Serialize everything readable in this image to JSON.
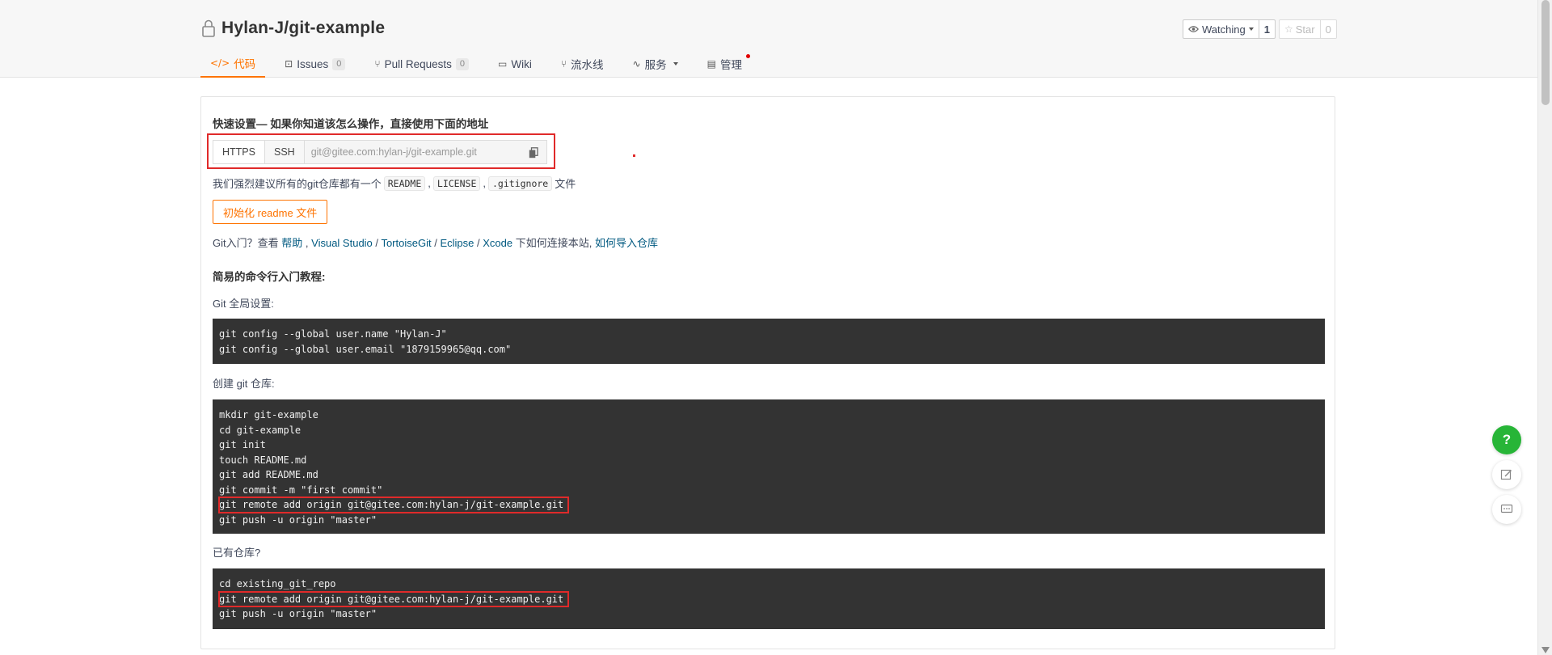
{
  "repo": {
    "title": "Hylan-J/git-example"
  },
  "watch": {
    "label": "Watching",
    "count": "1"
  },
  "star": {
    "label": "Star",
    "count": "0"
  },
  "tabs": [
    {
      "icon": "</>",
      "label": "代码"
    },
    {
      "icon": "⊡",
      "label": "Issues",
      "count": "0"
    },
    {
      "icon": "⑂",
      "label": "Pull Requests",
      "count": "0"
    },
    {
      "icon": "▭",
      "label": "Wiki"
    },
    {
      "icon": "⑂",
      "label": "流水线"
    },
    {
      "icon": "∿",
      "label": "服务"
    },
    {
      "icon": "▤",
      "label": "管理"
    }
  ],
  "quick_setup": {
    "title": "快速设置— 如果你知道该怎么操作，直接使用下面的地址",
    "https_label": "HTTPS",
    "ssh_label": "SSH",
    "url": "git@gitee.com:hylan-j/git-example.git"
  },
  "recommend": {
    "prefix": "我们强烈建议所有的git仓库都有一个",
    "files": [
      "README",
      "LICENSE",
      ".gitignore"
    ],
    "suffix": "文件",
    "sep": ","
  },
  "init_button": "初始化 readme 文件",
  "git_intro": {
    "prefix": "Git入门？查看",
    "help": "帮助",
    "vs": "Visual Studio",
    "tortoise": "TortoiseGit",
    "eclipse": "Eclipse",
    "xcode": "Xcode",
    "middle": "下如何连接本站,",
    "import": "如何导入仓库",
    "comma": ",",
    "slash": "/"
  },
  "tutorial": {
    "title": "简易的命令行入门教程:",
    "global_label": "Git 全局设置:",
    "global_lines": [
      "git config --global user.name \"Hylan-J\"",
      "git config --global user.email \"1879159965@qq.com\""
    ],
    "create_label": "创建 git 仓库:",
    "create_lines": [
      "mkdir git-example",
      "cd git-example",
      "git init",
      "touch README.md",
      "git add README.md",
      "git commit -m \"first commit\"",
      "git remote add origin git@gitee.com:hylan-j/git-example.git",
      "git push -u origin \"master\""
    ],
    "existing_label": "已有仓库?",
    "existing_lines": [
      "cd existing_git_repo",
      "git remote add origin git@gitee.com:hylan-j/git-example.git",
      "git push -u origin \"master\""
    ]
  },
  "float": {
    "help": "?"
  },
  "colors": {
    "accent": "#fe7300",
    "link": "#005980",
    "highlight": "#e02a2a",
    "code_bg": "#333333",
    "help_green": "#27b537"
  }
}
